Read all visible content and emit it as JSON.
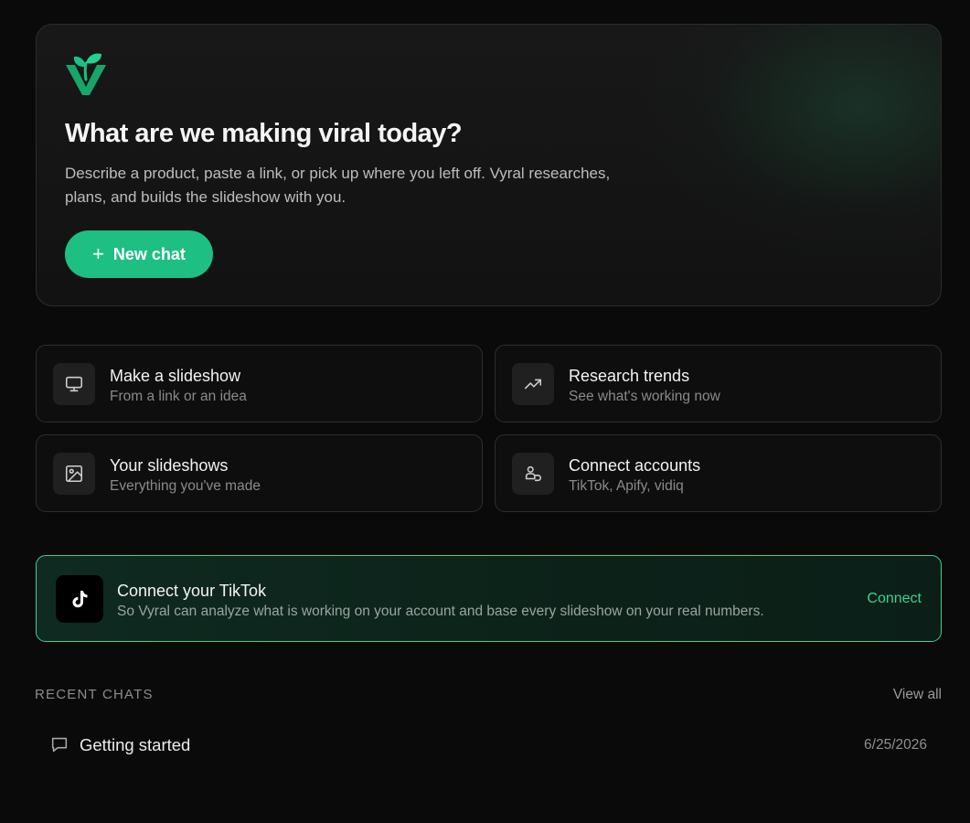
{
  "hero": {
    "logo_icon": "vyral-sprout-logo-icon",
    "title": "What are we making viral today?",
    "description": "Describe a product, paste a link, or pick up where you left off. Vyral researches, plans, and builds the slideshow with you.",
    "new_chat_icon": "plus-icon",
    "new_chat_label": "New chat"
  },
  "cards": [
    {
      "icon": "monitor-icon",
      "title": "Make a slideshow",
      "subtitle": "From a link or an idea"
    },
    {
      "icon": "trending-up-icon",
      "title": "Research trends",
      "subtitle": "See what's working now"
    },
    {
      "icon": "image-icon",
      "title": "Your slideshows",
      "subtitle": "Everything you've made"
    },
    {
      "icon": "link-accounts-icon",
      "title": "Connect accounts",
      "subtitle": "TikTok, Apify, vidiq"
    }
  ],
  "tiktok": {
    "icon": "tiktok-icon",
    "title": "Connect your TikTok",
    "subtitle": "So Vyral can analyze what is working on your account and base every slideshow on your real numbers.",
    "connect_label": "Connect"
  },
  "recent": {
    "label": "RECENT CHATS",
    "view_all": "View all",
    "items": [
      {
        "icon": "chat-bubble-icon",
        "title": "Getting started",
        "date": "6/25/2026"
      }
    ]
  },
  "colors": {
    "accent": "#1dbf83",
    "accent_text": "#39d391",
    "background": "#0a0a0a"
  }
}
